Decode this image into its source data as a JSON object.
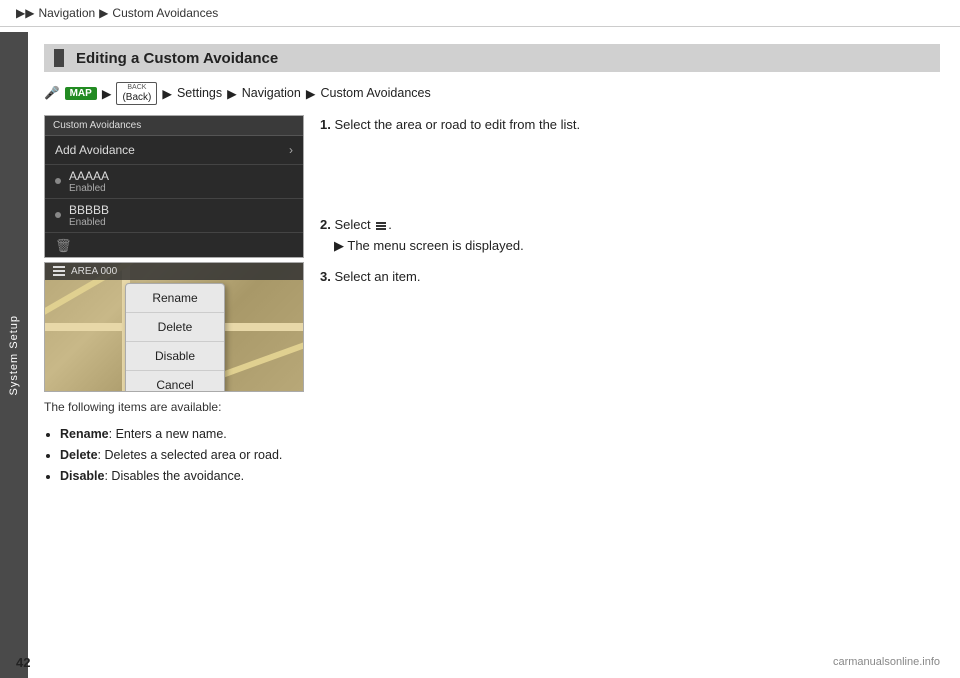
{
  "topbar": {
    "items": [
      "Navigation",
      "Custom Avoidances"
    ],
    "arrow": "▶"
  },
  "sidebar": {
    "label": "System Setup"
  },
  "section": {
    "heading": "Editing a Custom Avoidance"
  },
  "navpath": {
    "map_badge": "MAP",
    "back_top": "BACK",
    "back_label": "(Back)",
    "arrow": "▶",
    "items": [
      "Settings",
      "Navigation",
      "Custom Avoidances"
    ]
  },
  "ui_screen": {
    "header": "Custom Avoidances",
    "add_label": "Add Avoidance",
    "item1_name": "AAAAA",
    "item1_status": "Enabled",
    "item2_name": "BBBBB",
    "item2_status": "Enabled"
  },
  "map_header": {
    "area_label": "AREA 000"
  },
  "context_menu": {
    "rename": "Rename",
    "delete": "Delete",
    "disable": "Disable",
    "cancel": "Cancel"
  },
  "caption": "The following items are available:",
  "bullets": [
    {
      "term": "Rename",
      "desc": "Enters a new name."
    },
    {
      "term": "Delete",
      "desc": "Deletes a selected area or road."
    },
    {
      "term": "Disable",
      "desc": "Disables the avoidance."
    }
  ],
  "steps": [
    {
      "num": "1.",
      "text": "Select the area or road to edit from the list."
    },
    {
      "num": "2.",
      "text": "Select",
      "sub": "The menu screen is displayed."
    },
    {
      "num": "3.",
      "text": "Select an item."
    }
  ],
  "page_number": "42",
  "watermark": "carmanualsonline.info"
}
